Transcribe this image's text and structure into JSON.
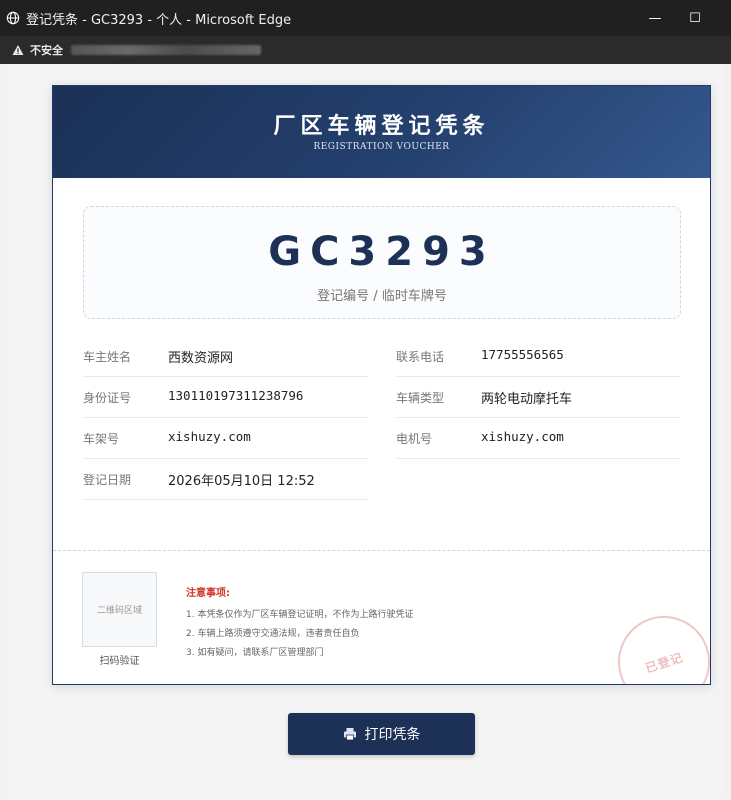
{
  "window": {
    "title": "登记凭条 - GC3293 - 个人 - Microsoft Edge",
    "minimize_glyph": "—",
    "maximize_glyph": "☐"
  },
  "address_bar": {
    "security_label": "不安全"
  },
  "voucher": {
    "title": "厂区车辆登记凭条",
    "subtitle": "REGISTRATION VOUCHER",
    "plate": "GC3293",
    "plate_label": "登记编号 / 临时车牌号",
    "fields": [
      {
        "label": "车主姓名",
        "value": "西数资源网"
      },
      {
        "label": "联系电话",
        "value": "17755556565"
      },
      {
        "label": "身份证号",
        "value": "130110197311238796"
      },
      {
        "label": "车辆类型",
        "value": "两轮电动摩托车"
      },
      {
        "label": "车架号",
        "value": "xishuzy.com"
      },
      {
        "label": "电机号",
        "value": "xishuzy.com"
      },
      {
        "label": "登记日期",
        "value": "2026年05月10日 12:52"
      }
    ],
    "qr_placeholder": "二维码区域",
    "qr_caption": "扫码验证",
    "notes_title": "注意事项:",
    "notes": [
      "1.  本凭条仅作为厂区车辆登记证明，不作为上路行驶凭证",
      "2.  车辆上路须遵守交通法规，违者责任自负",
      "3.  如有疑问，请联系厂区管理部门"
    ],
    "stamp_text": "已登记"
  },
  "print_button": {
    "label": "打印凭条"
  },
  "icons": {
    "window": "globe-icon",
    "security": "warning-icon",
    "print": "printer-icon"
  },
  "colors": {
    "brand_navy": "#1c3155",
    "warning_red": "#d0362a"
  }
}
